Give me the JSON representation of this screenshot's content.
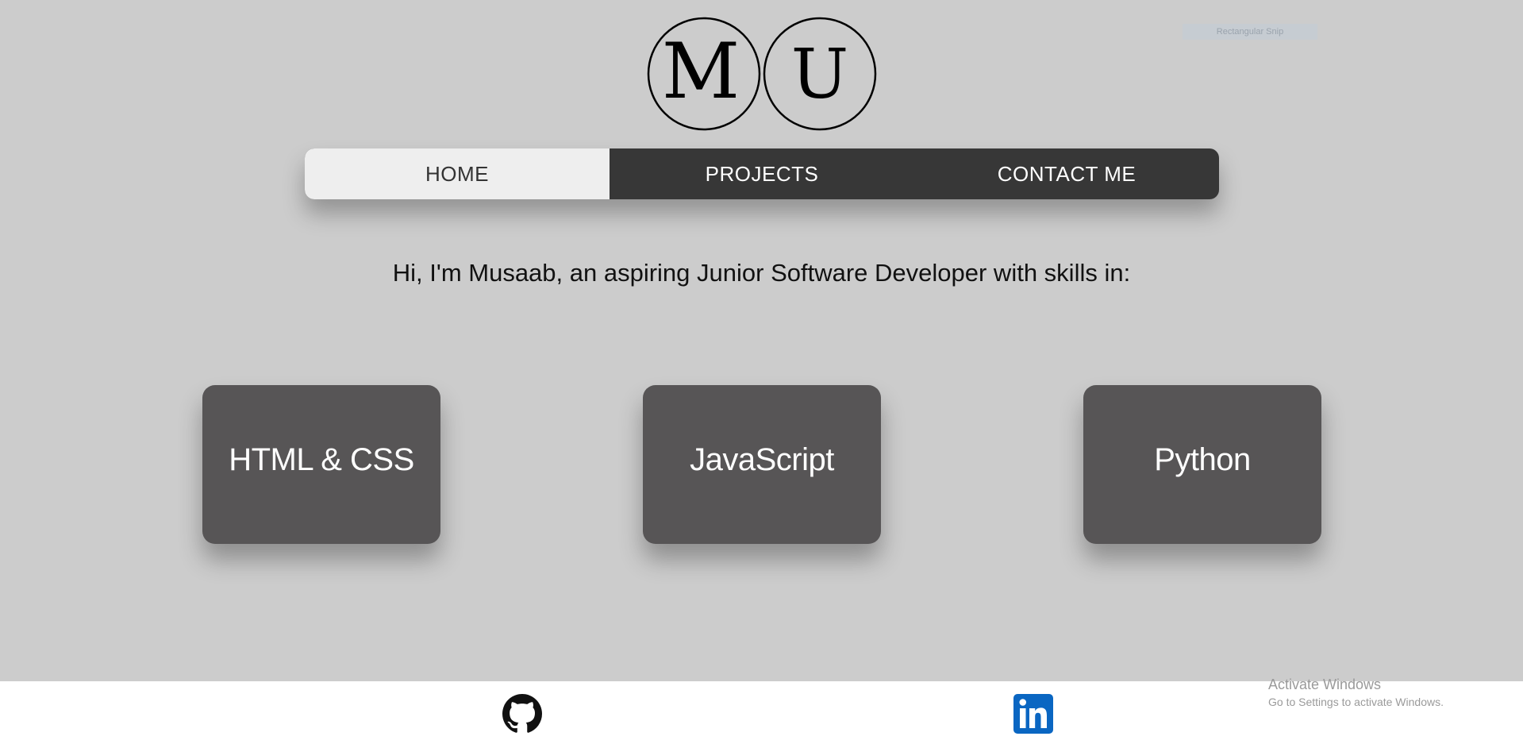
{
  "logo": {
    "letters": [
      "M",
      "U"
    ]
  },
  "snip_overlay": {
    "label": "Rectangular Snip"
  },
  "nav": {
    "items": [
      {
        "label": "HOME",
        "active": true
      },
      {
        "label": "PROJECTS",
        "active": false
      },
      {
        "label": "CONTACT ME",
        "active": false
      }
    ]
  },
  "intro": {
    "text": "Hi, I'm Musaab, an aspiring Junior Software Developer with skills in:"
  },
  "skills": [
    {
      "label": "HTML & CSS"
    },
    {
      "label": "JavaScript"
    },
    {
      "label": "Python"
    }
  ],
  "footer": {
    "github_icon": "github-icon",
    "linkedin_icon": "linkedin-icon"
  },
  "watermark": {
    "title": "Activate Windows",
    "subtitle": "Go to Settings to activate Windows."
  },
  "colors": {
    "background": "#cccccc",
    "nav_dark": "#373737",
    "nav_active": "#eeeeee",
    "card": "#575556",
    "linkedin_blue": "#0a66c2"
  }
}
